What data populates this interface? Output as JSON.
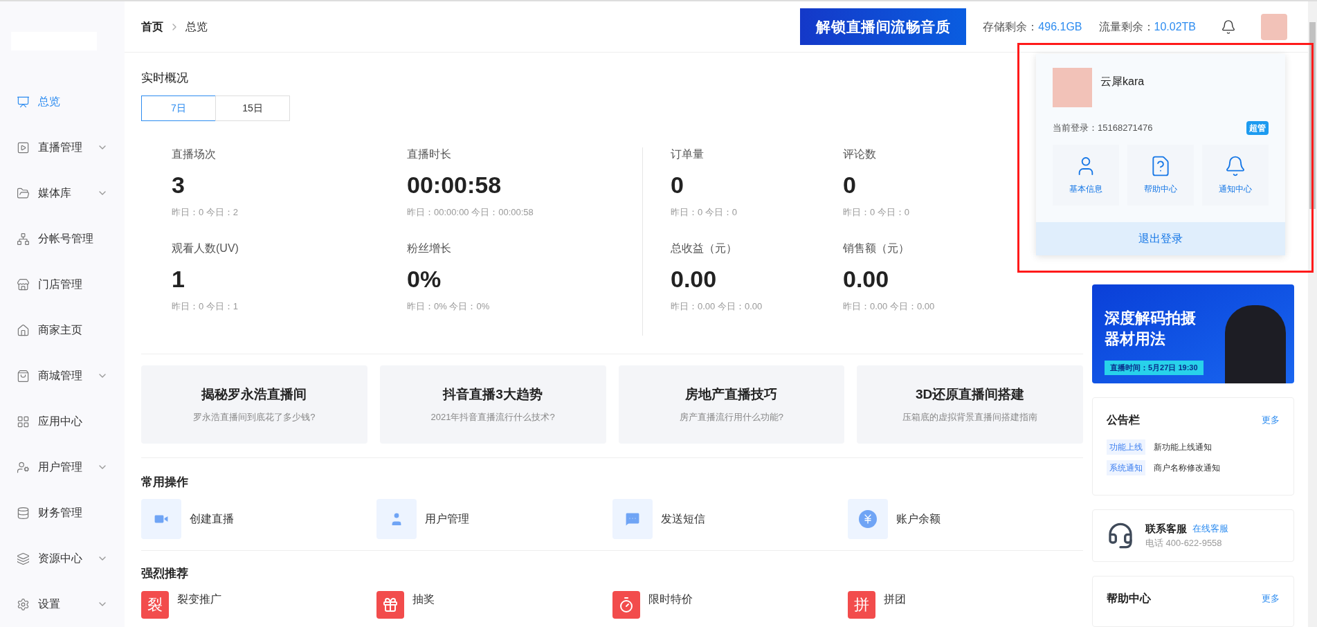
{
  "sidebar": {
    "items": [
      {
        "label": "总览",
        "selected": true,
        "expandable": false
      },
      {
        "label": "直播管理",
        "selected": false,
        "expandable": true
      },
      {
        "label": "媒体库",
        "selected": false,
        "expandable": true
      },
      {
        "label": "分帐号管理",
        "selected": false,
        "expandable": false
      },
      {
        "label": "门店管理",
        "selected": false,
        "expandable": false
      },
      {
        "label": "商家主页",
        "selected": false,
        "expandable": false
      },
      {
        "label": "商城管理",
        "selected": false,
        "expandable": true
      },
      {
        "label": "应用中心",
        "selected": false,
        "expandable": false
      },
      {
        "label": "用户管理",
        "selected": false,
        "expandable": true
      },
      {
        "label": "财务管理",
        "selected": false,
        "expandable": false
      },
      {
        "label": "资源中心",
        "selected": false,
        "expandable": true
      },
      {
        "label": "设置",
        "selected": false,
        "expandable": true
      }
    ]
  },
  "breadcrumb": [
    "首页",
    "总览"
  ],
  "header": {
    "promo": "解锁直播间流畅音质",
    "storage_label": "存储剩余：",
    "storage_value": "496.1GB",
    "traffic_label": "流量剩余：",
    "traffic_value": "10.02TB"
  },
  "overview": {
    "title": "实时概况",
    "ranges": [
      {
        "label": "7日",
        "selected": true
      },
      {
        "label": "15日",
        "selected": false
      }
    ],
    "stats": [
      {
        "label": "直播场次",
        "value": "3",
        "sub": "昨日：0 今日：2"
      },
      {
        "label": "直播时长",
        "value": "00:00:58",
        "sub": "昨日：00:00:00 今日：00:00:58"
      },
      {
        "label": "订单量",
        "value": "0",
        "sub": "昨日：0 今日：0"
      },
      {
        "label": "评论数",
        "value": "0",
        "sub": "昨日：0 今日：0"
      },
      {
        "label": "观看人数(UV)",
        "value": "1",
        "sub": "昨日：0 今日：1"
      },
      {
        "label": "粉丝增长",
        "value": "0%",
        "sub": "昨日：0% 今日：0%"
      },
      {
        "label": "总收益（元）",
        "value": "0.00",
        "sub": "昨日：0.00 今日：0.00"
      },
      {
        "label": "销售额（元）",
        "value": "0.00",
        "sub": "昨日：0.00 今日：0.00"
      }
    ]
  },
  "articles": [
    {
      "title": "揭秘罗永浩直播间",
      "subtitle": "罗永浩直播间到底花了多少钱?"
    },
    {
      "title": "抖音直播3大趋势",
      "subtitle": "2021年抖音直播流行什么技术?"
    },
    {
      "title": "房地产直播技巧",
      "subtitle": "房产直播流行用什么功能?"
    },
    {
      "title": "3D还原直播间搭建",
      "subtitle": "压箱底的虚拟背景直播间搭建指南"
    }
  ],
  "quick_actions": {
    "title": "常用操作",
    "items": [
      {
        "label": "创建直播"
      },
      {
        "label": "用户管理"
      },
      {
        "label": "发送短信"
      },
      {
        "label": "账户余额"
      }
    ]
  },
  "recommend": {
    "title": "强烈推荐",
    "items": [
      {
        "label": "裂变推广",
        "kind": "glyph",
        "glyph": "裂"
      },
      {
        "label": "抽奖",
        "kind": "icon"
      },
      {
        "label": "限时特价",
        "kind": "icon"
      },
      {
        "label": "拼团",
        "kind": "glyph",
        "glyph": "拼"
      }
    ]
  },
  "user_menu": {
    "name": "云犀kara",
    "login": "当前登录：15168271476",
    "role": "超管",
    "actions": [
      "基本信息",
      "帮助中心",
      "通知中心"
    ],
    "logout": "退出登录"
  },
  "live_banner": {
    "headline": [
      "深度解码拍摄",
      "器材用法"
    ],
    "time": "直播时间：5月27日 19:30"
  },
  "notices": {
    "title": "公告栏",
    "more": "更多",
    "items": [
      {
        "tag": "功能上线",
        "text": "新功能上线通知"
      },
      {
        "tag": "系统通知",
        "text": "商户名称修改通知"
      }
    ]
  },
  "support": {
    "title": "联系客服",
    "link": "在线客服",
    "phone": "电话 400-622-9558"
  },
  "help": {
    "title": "帮助中心",
    "more": "更多"
  }
}
